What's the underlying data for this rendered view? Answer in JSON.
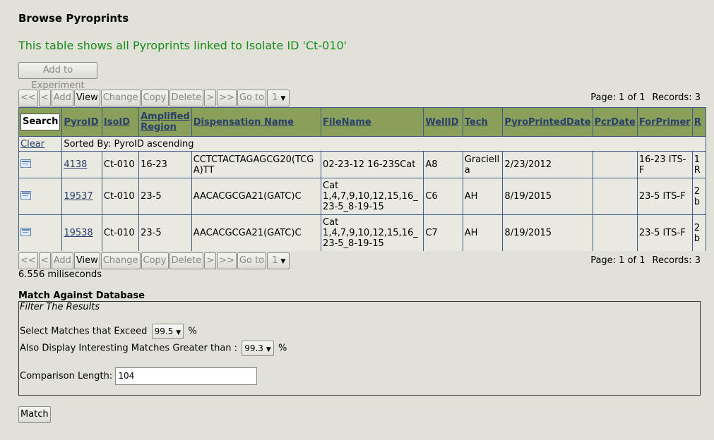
{
  "page_title": "Browse Pyroprints",
  "subtitle": "This table shows all Pyroprints linked to Isolate ID 'Ct-010'",
  "add_experiment_label": "Add to Experiment",
  "pager": {
    "first": "<<",
    "prev": "<",
    "add": "Add",
    "view": "View",
    "change": "Change",
    "copy": "Copy",
    "delete": "Delete",
    "next": ">",
    "last": ">>",
    "goto": "Go to",
    "page_select": "1",
    "page_info": "Page: 1 of 1",
    "records": "Records: 3"
  },
  "table": {
    "search_label": "Search",
    "clear_label": "Clear",
    "sorted_by": "Sorted By: PyroID ascending",
    "columns": [
      "PyroID",
      "IsoID",
      "Amplified Region",
      "Dispensation Name",
      "FileName",
      "WellID",
      "Tech",
      "PyroPrintedDate",
      "PcrDate",
      "ForPrimer",
      "R"
    ],
    "rows": [
      {
        "pyro_id": "4138",
        "iso_id": "Ct-010",
        "region": "16-23",
        "dispensation": "CCTCTACTAGAGCG20(TCGA)TT",
        "filename": "02-23-12 16-23SCat",
        "well_id": "A8",
        "tech": "Graciella",
        "printed_date": "2/23/2012",
        "pcr_date": "",
        "for_primer": "16-23 ITS-F",
        "rev": "1 R"
      },
      {
        "pyro_id": "19537",
        "iso_id": "Ct-010",
        "region": "23-5",
        "dispensation": "AACACGCGA21(GATC)C",
        "filename": "Cat 1,4,7,9,10,12,15,16_23-5_8-19-15",
        "well_id": "C6",
        "tech": "AH",
        "printed_date": "8/19/2015",
        "pcr_date": "",
        "for_primer": "23-5 ITS-F",
        "rev": "2 b"
      },
      {
        "pyro_id": "19538",
        "iso_id": "Ct-010",
        "region": "23-5",
        "dispensation": "AACACGCGA21(GATC)C",
        "filename": "Cat 1,4,7,9,10,12,15,16_23-5_8-19-15",
        "well_id": "C7",
        "tech": "AH",
        "printed_date": "8/19/2015",
        "pcr_date": "",
        "for_primer": "23-5 ITS-F",
        "rev": "2 b"
      }
    ]
  },
  "timing": "6.556 miliseconds",
  "match": {
    "title": "Match Against Database",
    "legend": "Filter The Results",
    "exceed_label": "Select Matches that Exceed",
    "exceed_value": "99.5",
    "interesting_label": "Also Display Interesting Matches Greater than :",
    "interesting_value": "99.3",
    "percent": "%",
    "comparison_label": "Comparison Length:",
    "comparison_value": "104",
    "match_button": "Match"
  }
}
